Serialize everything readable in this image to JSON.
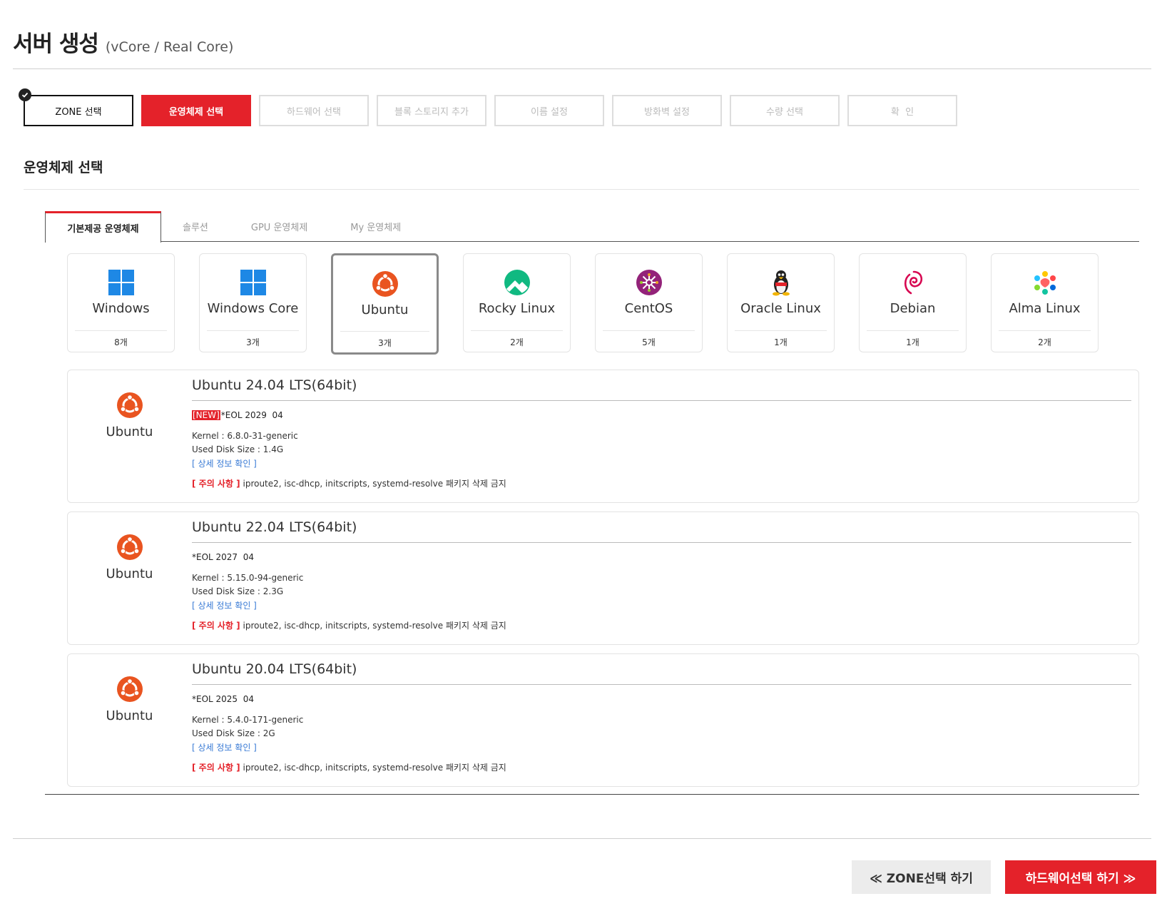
{
  "header": {
    "title": "서버 생성",
    "subtitle": "(vCore / Real Core)"
  },
  "steps": [
    {
      "label": "ZONE 선택",
      "state": "done"
    },
    {
      "label": "운영체제 선택",
      "state": "active"
    },
    {
      "label": "하드웨어 선택",
      "state": "pending"
    },
    {
      "label": "블록 스토리지 추가",
      "state": "pending"
    },
    {
      "label": "이름 설정",
      "state": "pending"
    },
    {
      "label": "방화벽 설정",
      "state": "pending"
    },
    {
      "label": "수량 선택",
      "state": "pending"
    },
    {
      "label": "확  인",
      "state": "pending"
    }
  ],
  "section": {
    "title": "운영체제 선택"
  },
  "tabs": [
    {
      "label": "기본제공 운영체제",
      "active": true
    },
    {
      "label": "솔루션",
      "active": false
    },
    {
      "label": "GPU 운영체제",
      "active": false
    },
    {
      "label": "My 운영체제",
      "active": false
    }
  ],
  "os_list": [
    {
      "name": "Windows",
      "count": "8개",
      "icon": "windows-icon"
    },
    {
      "name": "Windows Core",
      "count": "3개",
      "icon": "windows-icon"
    },
    {
      "name": "Ubuntu",
      "count": "3개",
      "icon": "ubuntu-icon",
      "selected": true
    },
    {
      "name": "Rocky Linux",
      "count": "2개",
      "icon": "rocky-linux-icon"
    },
    {
      "name": "CentOS",
      "count": "5개",
      "icon": "centos-icon"
    },
    {
      "name": "Oracle Linux",
      "count": "1개",
      "icon": "tux-penguin-icon"
    },
    {
      "name": "Debian",
      "count": "1개",
      "icon": "debian-swirl-icon"
    },
    {
      "name": "Alma Linux",
      "count": "2개",
      "icon": "alma-linux-icon"
    }
  ],
  "versions": [
    {
      "os_name": "Ubuntu",
      "title": "Ubuntu 24.04 LTS(64bit)",
      "new_badge": "[NEW]",
      "eol": "*EOL 2029  04",
      "kernel": "Kernel : 6.8.0-31-generic",
      "disk": "Used Disk Size : 1.4G",
      "detail_link": "[ 상세 정보 확인 ]",
      "warning_label": "[ 주의 사항 ]",
      "warning_text": " iproute2, isc-dhcp, initscripts, systemd-resolve 패키지 삭제 금지"
    },
    {
      "os_name": "Ubuntu",
      "title": "Ubuntu 22.04 LTS(64bit)",
      "new_badge": "",
      "eol": "*EOL 2027  04",
      "kernel": "Kernel : 5.15.0-94-generic",
      "disk": "Used Disk Size : 2.3G",
      "detail_link": "[ 상세 정보 확인 ]",
      "warning_label": "[ 주의 사항 ]",
      "warning_text": " iproute2, isc-dhcp, initscripts, systemd-resolve 패키지 삭제 금지"
    },
    {
      "os_name": "Ubuntu",
      "title": "Ubuntu 20.04 LTS(64bit)",
      "new_badge": "",
      "eol": "*EOL 2025  04",
      "kernel": "Kernel : 5.4.0-171-generic",
      "disk": "Used Disk Size : 2G",
      "detail_link": "[ 상세 정보 확인 ]",
      "warning_label": "[ 주의 사항 ]",
      "warning_text": " iproute2, isc-dhcp, initscripts, systemd-resolve 패키지 삭제 금지"
    }
  ],
  "buttons": {
    "prev": "≪ ZONE선택 하기",
    "next": "하드웨어선택 하기 ≫"
  },
  "colors": {
    "accent": "#e4222a",
    "ubuntu": "#e95420",
    "link": "#3a7bd5"
  }
}
